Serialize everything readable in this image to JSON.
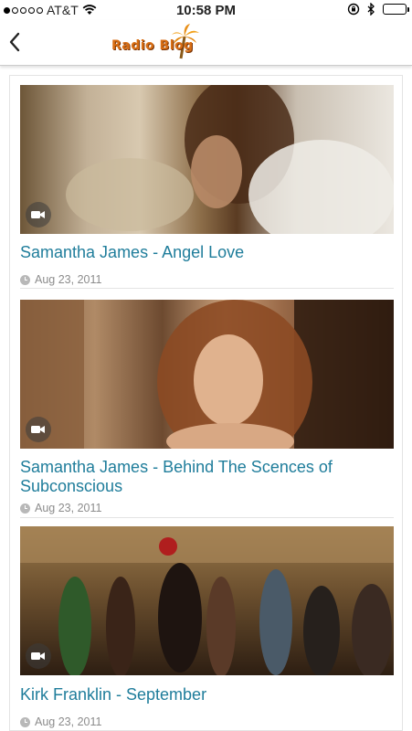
{
  "status_bar": {
    "carrier": "AT&T",
    "time": "10:58 PM"
  },
  "nav": {
    "logo_text": "Radio Blog"
  },
  "feed": {
    "items": [
      {
        "title": "Samantha James - Angel Love",
        "date": "Aug 23, 2011",
        "media_type": "video"
      },
      {
        "title": "Samantha James - Behind The Scences of Subconscious",
        "date": "Aug 23, 2011",
        "media_type": "video"
      },
      {
        "title": "Kirk Franklin - September",
        "date": "Aug 23, 2011",
        "media_type": "video"
      }
    ]
  },
  "colors": {
    "title_link": "#1f7d9b",
    "date_text": "#8c8c8c",
    "logo_orange": "#d86e14"
  }
}
